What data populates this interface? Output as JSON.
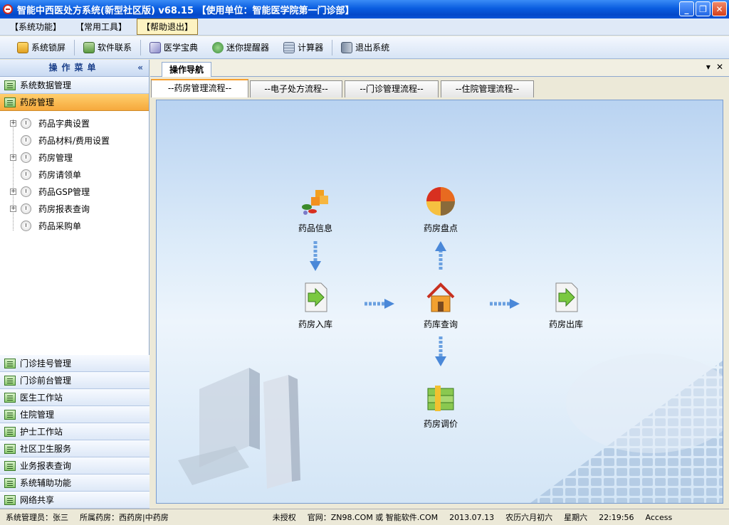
{
  "window": {
    "title": "智能中西医处方系统(新型社区版) v68.15 【使用单位：智能医学院第一门诊部】"
  },
  "menu": {
    "items": [
      "【系统功能】",
      "【常用工具】",
      "【帮助退出】"
    ]
  },
  "toolbar": {
    "lock": "系统锁屏",
    "contact": "软件联系",
    "medical": "医学宝典",
    "reminder": "迷你提醒器",
    "calculator": "计算器",
    "exit": "退出系统"
  },
  "sidebar": {
    "title": "操作菜单",
    "collapse": "«",
    "top_groups": [
      "系统数据管理",
      "药房管理"
    ],
    "tree": [
      {
        "label": "药品字典设置",
        "expandable": true
      },
      {
        "label": "药品材料/费用设置",
        "expandable": false
      },
      {
        "label": "药房管理",
        "expandable": true
      },
      {
        "label": "药房请领单",
        "expandable": false
      },
      {
        "label": "药品GSP管理",
        "expandable": true
      },
      {
        "label": "药房报表查询",
        "expandable": true
      },
      {
        "label": "药品采购单",
        "expandable": false
      }
    ],
    "bottom_groups": [
      "门诊挂号管理",
      "门诊前台管理",
      "医生工作站",
      "住院管理",
      "护士工作站",
      "社区卫生服务",
      "业务报表查询",
      "系统辅助功能",
      "网络共享"
    ]
  },
  "main": {
    "tab": "操作导航",
    "tab_menu": "▾",
    "tab_close": "✕",
    "subtabs": [
      "--药房管理流程--",
      "--电子处方流程--",
      "--门诊管理流程--",
      "--住院管理流程--"
    ],
    "flow": {
      "drug_info": "药品信息",
      "inventory_check": "药房盘点",
      "stock_in": "药房入库",
      "stock_query": "药库查询",
      "stock_out": "药房出库",
      "price_adjust": "药房调价"
    }
  },
  "status": {
    "operator": "系统管理员：张三",
    "pharmacy": "所属药房：西药房|中药房",
    "license": "未授权",
    "website": "官网：ZN98.COM 或 智能软件.COM",
    "date": "2013.07.13",
    "lunar": "农历六月初六",
    "weekday": "星期六",
    "time": "22:19:56",
    "db": "Access"
  },
  "colors": {
    "title_blue": "#0a5de0",
    "selected_orange": "#f6a93c",
    "canvas_blue": "#b9d3f1"
  }
}
